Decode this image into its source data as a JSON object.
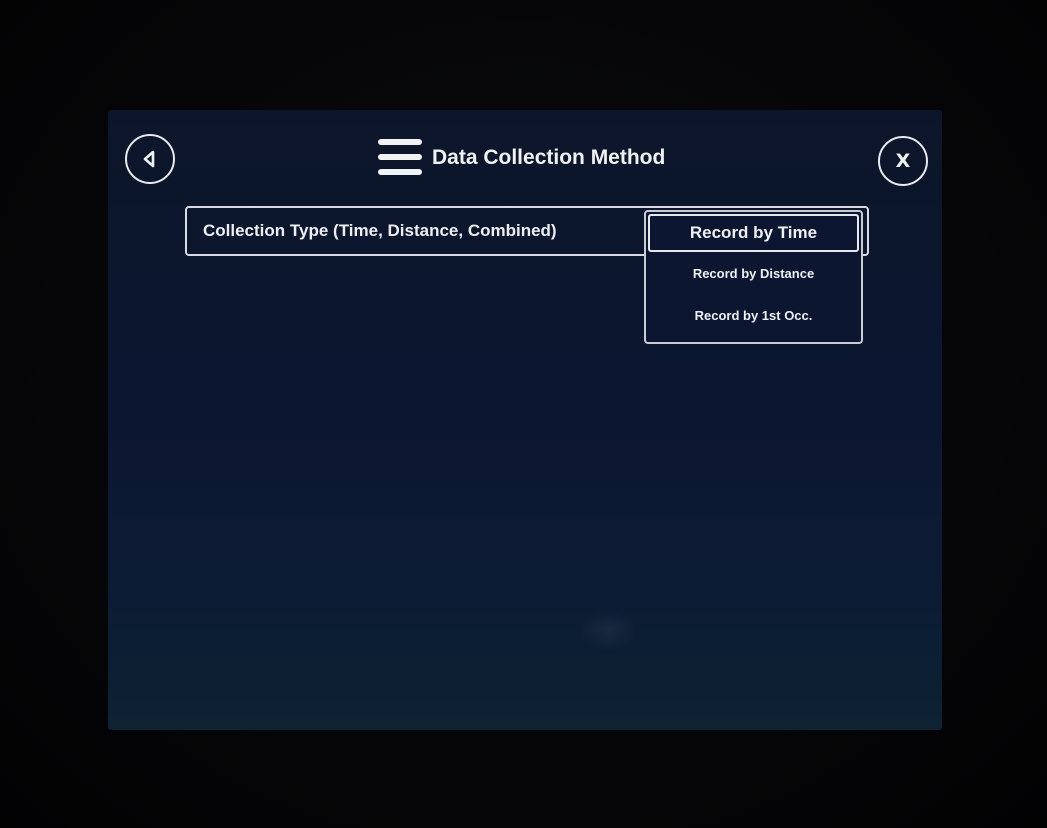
{
  "header": {
    "title": "Data Collection Method"
  },
  "icons": {
    "back": "back-arrow-icon",
    "menu": "hamburger-menu-icon",
    "close": "close-icon"
  },
  "close_label": "X",
  "field": {
    "label": "Collection Type (Time, Distance, Combined)"
  },
  "dropdown": {
    "selected": "Record by Time",
    "options": [
      "Record by Time",
      "Record by Distance",
      "Record by 1st Occ."
    ]
  },
  "colors": {
    "screen_background": "#0b1630",
    "foreground": "#eef0f3"
  }
}
